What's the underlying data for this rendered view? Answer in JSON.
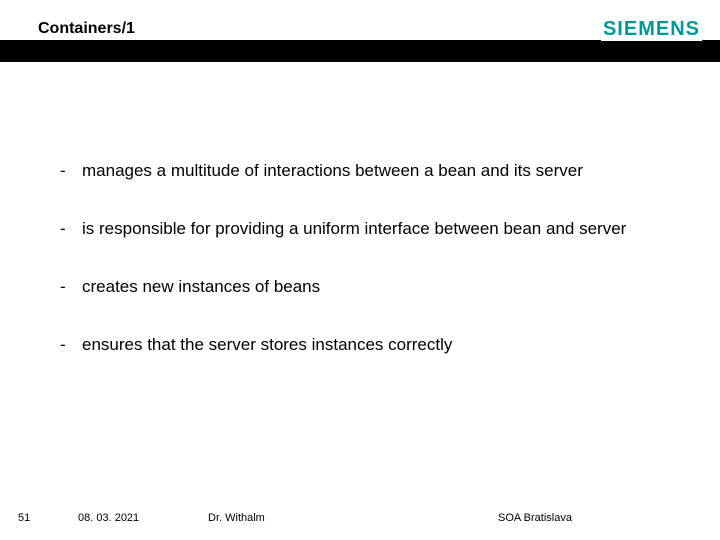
{
  "header": {
    "title": "Containers/1",
    "logo": "SIEMENS"
  },
  "bullets": [
    "manages a multitude of interactions between a bean and its server",
    "is responsible for providing a uniform interface between bean and server",
    "creates new instances of beans",
    "ensures that the server stores instances correctly"
  ],
  "dash": "-",
  "footer": {
    "page_number": "51",
    "date": "08. 03. 2021",
    "author": "Dr. Withalm",
    "venue": "SOA Bratislava"
  }
}
